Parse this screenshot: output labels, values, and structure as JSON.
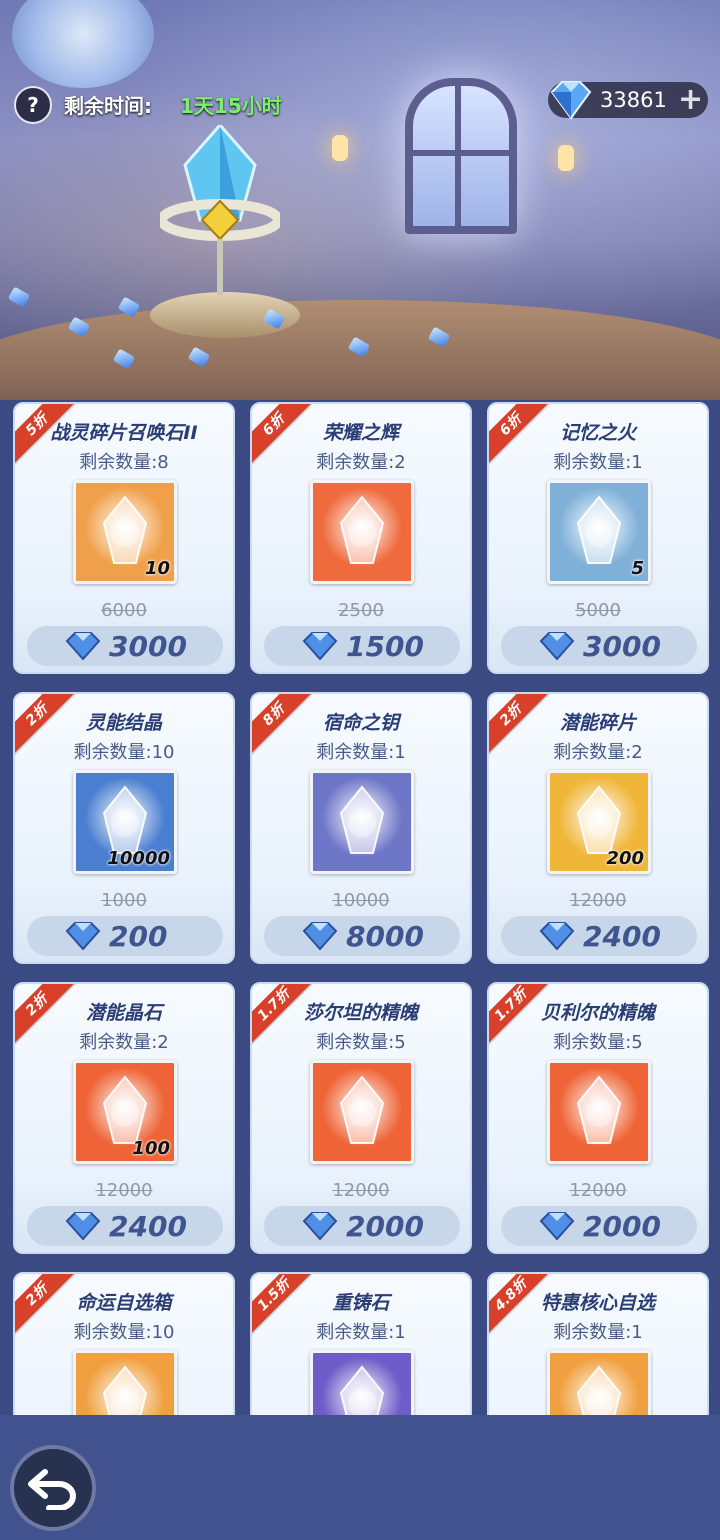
{
  "header": {
    "help_icon": "question-icon",
    "timer_label": "剩余时间:",
    "timer_value": "1天15小时",
    "currency_value": "33861",
    "currency_icon": "diamond-icon",
    "plus_icon": "plus-icon"
  },
  "items": [
    {
      "discount": "5折",
      "name": "战灵碎片召唤石II",
      "stock": "剩余数量:8",
      "qty": "10",
      "old_price": "6000",
      "price": "3000",
      "icon": "summon-stone-icon",
      "bg": "#f0a04a"
    },
    {
      "discount": "6折",
      "name": "荣耀之辉",
      "stock": "剩余数量:2",
      "qty": "",
      "old_price": "2500",
      "price": "1500",
      "icon": "glory-orb-icon",
      "bg": "#ef6a3c"
    },
    {
      "discount": "6折",
      "name": "记忆之火",
      "stock": "剩余数量:1",
      "qty": "5",
      "old_price": "5000",
      "price": "3000",
      "icon": "memory-fire-icon",
      "bg": "#7fb0d8"
    },
    {
      "discount": "2折",
      "name": "灵能结晶",
      "stock": "剩余数量:10",
      "qty": "10000",
      "old_price": "1000",
      "price": "200",
      "icon": "psionic-crystal-icon",
      "bg": "#4a7ed0"
    },
    {
      "discount": "8折",
      "name": "宿命之钥",
      "stock": "剩余数量:1",
      "qty": "",
      "old_price": "10000",
      "price": "8000",
      "icon": "destiny-key-icon",
      "bg": "#6e76c8"
    },
    {
      "discount": "2折",
      "name": "潜能碎片",
      "stock": "剩余数量:2",
      "qty": "200",
      "old_price": "12000",
      "price": "2400",
      "icon": "potential-shard-icon",
      "bg": "#f0b63a"
    },
    {
      "discount": "2折",
      "name": "潜能晶石",
      "stock": "剩余数量:2",
      "qty": "100",
      "old_price": "12000",
      "price": "2400",
      "icon": "potential-spar-icon",
      "bg": "#ee6436"
    },
    {
      "discount": "1.7折",
      "name": "莎尔坦的精魄",
      "stock": "剩余数量:5",
      "qty": "",
      "old_price": "12000",
      "price": "2000",
      "icon": "essence-orb-purple-icon",
      "bg": "#ee6436"
    },
    {
      "discount": "1.7折",
      "name": "贝利尔的精魄",
      "stock": "剩余数量:5",
      "qty": "",
      "old_price": "12000",
      "price": "2000",
      "icon": "essence-orb-red-icon",
      "bg": "#ee6436"
    },
    {
      "discount": "2折",
      "name": "命运自选箱",
      "stock": "剩余数量:10",
      "qty": "",
      "old_price": "",
      "price": "",
      "icon": "fate-chest-icon",
      "bg": "#f0a040"
    },
    {
      "discount": "1.5折",
      "name": "重铸石",
      "stock": "剩余数量:1",
      "qty": "",
      "old_price": "",
      "price": "",
      "icon": "reforge-stone-icon",
      "bg": "#6e5cc8"
    },
    {
      "discount": "4.8折",
      "name": "特惠核心自选",
      "stock": "剩余数量:1",
      "qty": "",
      "old_price": "",
      "price": "",
      "icon": "core-select-icon",
      "bg": "#f0a040"
    }
  ],
  "footer": {
    "back_icon": "back-arrow-icon"
  },
  "colors": {
    "ribbon": "#d8402a",
    "timer_value": "#7cf06e",
    "price_text": "#3f5590"
  }
}
